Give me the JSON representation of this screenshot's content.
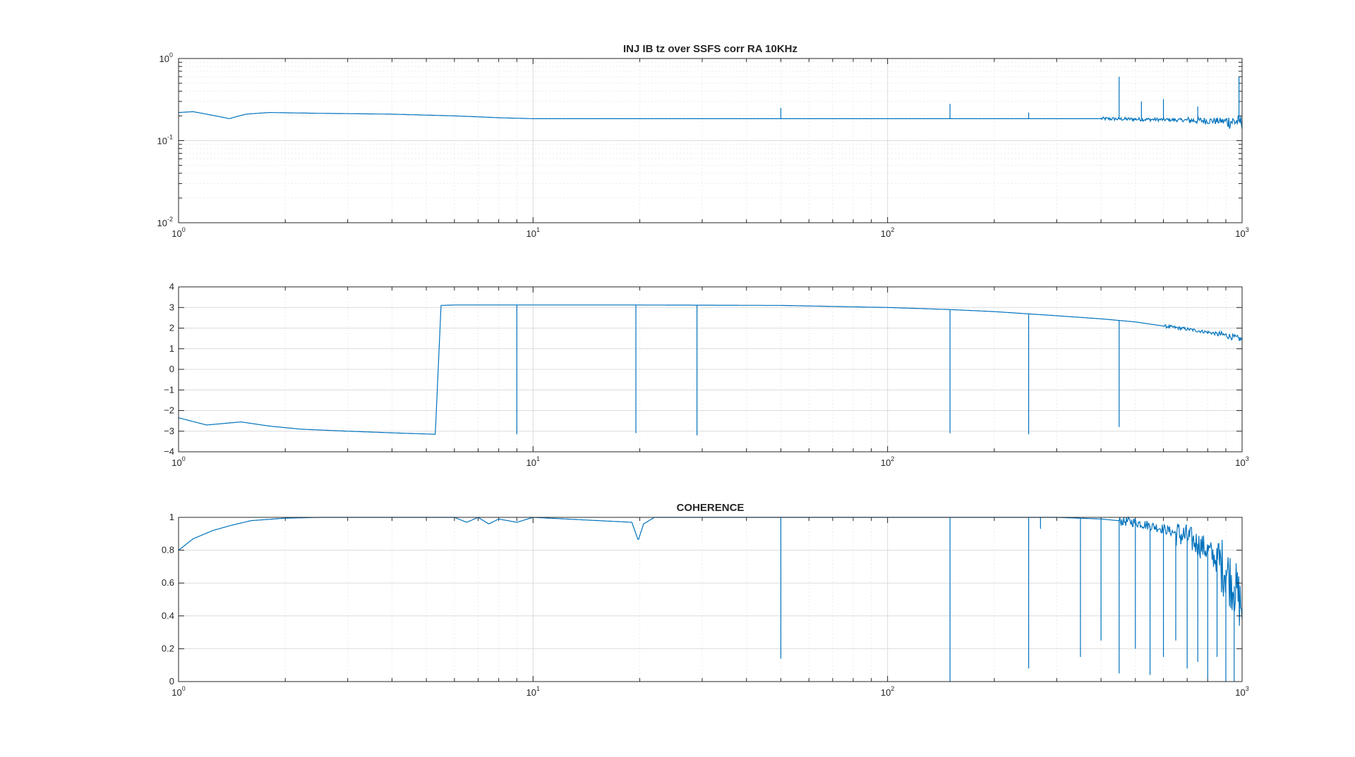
{
  "colors": {
    "line": "#0072bd",
    "axis": "#262626",
    "grid": "#dcdcdc",
    "minorGrid": "#ececec",
    "background": "#ffffff"
  },
  "chart_data": [
    {
      "type": "line",
      "title": "INJ IB tz over SSFS corr RA 10KHz",
      "xscale": "log",
      "yscale": "log",
      "xlim": [
        1,
        1000
      ],
      "ylim": [
        0.01,
        1
      ],
      "grid": true,
      "xticks": [
        {
          "base": "10",
          "exp": "0",
          "value": 1
        },
        {
          "base": "10",
          "exp": "1",
          "value": 10
        },
        {
          "base": "10",
          "exp": "2",
          "value": 100
        },
        {
          "base": "10",
          "exp": "3",
          "value": 1000
        }
      ],
      "yticks": [
        {
          "base": "10",
          "exp": "-2",
          "value": 0.01
        },
        {
          "base": "10",
          "exp": "-1",
          "value": 0.1
        },
        {
          "base": "10",
          "exp": "0",
          "value": 1
        }
      ],
      "series": [
        {
          "x": [
            1,
            1.1,
            1.2,
            1.39,
            1.55,
            1.8,
            2.5,
            4,
            6,
            8,
            10,
            20,
            50,
            100,
            200,
            400,
            600,
            800,
            1000
          ],
          "y": [
            0.22,
            0.225,
            0.21,
            0.185,
            0.21,
            0.22,
            0.215,
            0.21,
            0.2,
            0.19,
            0.185,
            0.185,
            0.185,
            0.185,
            0.185,
            0.185,
            0.18,
            0.175,
            0.17
          ],
          "spikes": [
            {
              "x": 50,
              "y": 0.25
            },
            {
              "x": 150,
              "y": 0.28
            },
            {
              "x": 250,
              "y": 0.22
            },
            {
              "x": 450,
              "y": 0.6
            },
            {
              "x": 520,
              "y": 0.3
            },
            {
              "x": 600,
              "y": 0.32
            },
            {
              "x": 750,
              "y": 0.26
            },
            {
              "x": 980,
              "y": 0.6
            }
          ],
          "noise": [
            {
              "from": 400,
              "amp": 0.05
            },
            {
              "from": 700,
              "amp": 0.1
            },
            {
              "from": 900,
              "amp": 0.2
            }
          ]
        }
      ]
    },
    {
      "type": "line",
      "title": "",
      "xscale": "log",
      "yscale": "linear",
      "xlim": [
        1,
        1000
      ],
      "ylim": [
        -4,
        4
      ],
      "grid": true,
      "xticks": [
        {
          "base": "10",
          "exp": "0",
          "value": 1
        },
        {
          "base": "10",
          "exp": "1",
          "value": 10
        },
        {
          "base": "10",
          "exp": "2",
          "value": 100
        },
        {
          "base": "10",
          "exp": "3",
          "value": 1000
        }
      ],
      "yticks": [
        {
          "label": "−4",
          "value": -4
        },
        {
          "label": "−3",
          "value": -3
        },
        {
          "label": "−2",
          "value": -2
        },
        {
          "label": "−1",
          "value": -1
        },
        {
          "label": "0",
          "value": 0
        },
        {
          "label": "1",
          "value": 1
        },
        {
          "label": "2",
          "value": 2
        },
        {
          "label": "3",
          "value": 3
        },
        {
          "label": "4",
          "value": 4
        }
      ],
      "series": [
        {
          "x": [
            1,
            1.2,
            1.5,
            1.8,
            2.2,
            3,
            4,
            5.3,
            5.5,
            6,
            8,
            10,
            20,
            50,
            100,
            150,
            200,
            300,
            400,
            500,
            600,
            700,
            800,
            900,
            1000
          ],
          "y": [
            -2.35,
            -2.7,
            -2.55,
            -2.75,
            -2.9,
            -3.0,
            -3.08,
            -3.15,
            3.1,
            3.12,
            3.12,
            3.12,
            3.12,
            3.1,
            3.0,
            2.9,
            2.8,
            2.6,
            2.45,
            2.3,
            2.1,
            1.95,
            1.8,
            1.65,
            1.45
          ],
          "spikes": [
            {
              "x": 9,
              "y": -3.15
            },
            {
              "x": 19.5,
              "y": -3.1
            },
            {
              "x": 29,
              "y": -3.2
            },
            {
              "x": 150,
              "y": -3.1
            },
            {
              "x": 250,
              "y": -3.15
            },
            {
              "x": 450,
              "y": -2.8
            }
          ],
          "noise": [
            {
              "from": 600,
              "amp": 0.08
            },
            {
              "from": 850,
              "amp": 0.15
            }
          ]
        }
      ]
    },
    {
      "type": "line",
      "title": "COHERENCE",
      "xscale": "log",
      "yscale": "linear",
      "xlim": [
        1,
        1000
      ],
      "ylim": [
        0,
        1
      ],
      "grid": true,
      "xticks": [
        {
          "base": "10",
          "exp": "0",
          "value": 1
        },
        {
          "base": "10",
          "exp": "1",
          "value": 10
        },
        {
          "base": "10",
          "exp": "2",
          "value": 100
        },
        {
          "base": "10",
          "exp": "3",
          "value": 1000
        }
      ],
      "yticks": [
        {
          "label": "0",
          "value": 0
        },
        {
          "label": "0.2",
          "value": 0.2
        },
        {
          "label": "0.4",
          "value": 0.4
        },
        {
          "label": "0.6",
          "value": 0.6
        },
        {
          "label": "0.8",
          "value": 0.8
        },
        {
          "label": "1",
          "value": 1
        }
      ],
      "series": [
        {
          "x": [
            1,
            1.1,
            1.25,
            1.4,
            1.6,
            2,
            2.5,
            6,
            6.5,
            7,
            7.5,
            8,
            9,
            10,
            19,
            19.8,
            20.5,
            22,
            50,
            100,
            300,
            400,
            500,
            600,
            700,
            800,
            900,
            950,
            1000
          ],
          "y": [
            0.8,
            0.87,
            0.92,
            0.95,
            0.98,
            0.995,
            1,
            1,
            0.97,
            1,
            0.96,
            0.99,
            0.97,
            1,
            0.97,
            0.86,
            0.96,
            1,
            1,
            1,
            1,
            0.99,
            0.97,
            0.93,
            0.88,
            0.8,
            0.68,
            0.58,
            0.45
          ],
          "spikes": [
            {
              "x": 50,
              "y": 0.14
            },
            {
              "x": 150,
              "y": 0.0
            },
            {
              "x": 250,
              "y": 0.08
            },
            {
              "x": 270,
              "y": 0.93
            },
            {
              "x": 350,
              "y": 0.15
            },
            {
              "x": 400,
              "y": 0.25
            },
            {
              "x": 450,
              "y": 0.05
            },
            {
              "x": 500,
              "y": 0.2
            },
            {
              "x": 550,
              "y": 0.04
            },
            {
              "x": 600,
              "y": 0.15
            },
            {
              "x": 650,
              "y": 0.25
            },
            {
              "x": 700,
              "y": 0.08
            },
            {
              "x": 750,
              "y": 0.12
            },
            {
              "x": 800,
              "y": 0.02
            },
            {
              "x": 850,
              "y": 0.15
            },
            {
              "x": 900,
              "y": 0.0
            },
            {
              "x": 950,
              "y": 0.0
            }
          ],
          "noise": [
            {
              "from": 450,
              "amp": 0.03
            },
            {
              "from": 650,
              "amp": 0.08
            },
            {
              "from": 850,
              "amp": 0.18
            }
          ]
        }
      ]
    }
  ]
}
